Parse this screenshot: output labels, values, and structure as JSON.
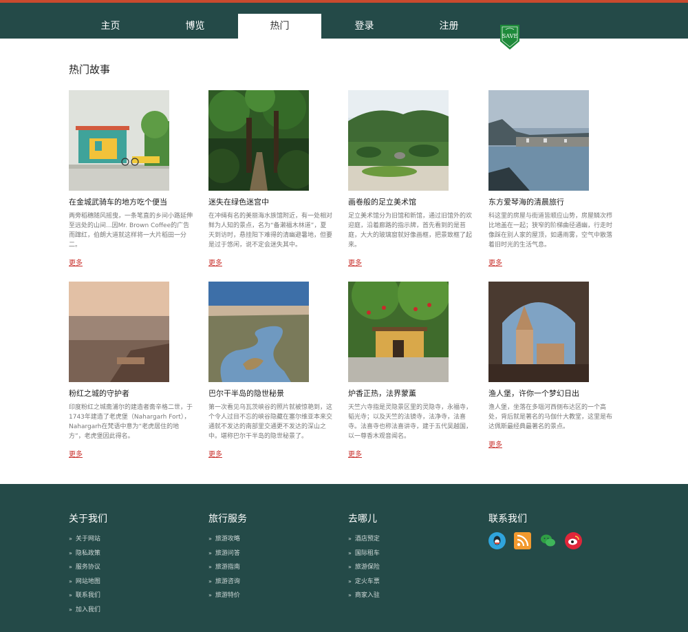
{
  "nav": {
    "items": [
      "主页",
      "博览",
      "热门",
      "登录",
      "注册"
    ],
    "active_index": 2,
    "save_badge": "SAVE"
  },
  "section": {
    "title": "热门故事"
  },
  "cards": [
    {
      "title": "在金城武骑车的地方吃个便当",
      "desc": "两旁稻穗随风摇曳，一条笔直的乡间小路延伸至远处的山间...因Mr. Brown Coffee的广告而蹿红，伯朗大道就这样将一大片稻田一分二。",
      "more": "更多"
    },
    {
      "title": "迷失在绿色迷宫中",
      "desc": "在冲绳有名的美丽海水族馆附近，有一处相对鲜为人知的景点，名为“备濑福木林道”，夏天到访时，悬挂阳下难得的清幽避暑地，但要是过于悠闲，说不定会迷失其中。",
      "more": "更多"
    },
    {
      "title": "画卷般的足立美术馆",
      "desc": "足立美术馆分为旧馆和新馆，通过旧馆外的欢迎庭，沿着廊路的指示牌，首先看到的是苔庭，大大的玻璃窗就好像画框，把景致框了起来。",
      "more": "更多"
    },
    {
      "title": "东方爱琴海的清晨旅行",
      "desc": "科这里的房屋与街道皆顺应山势，房屋鳞次栉比地盖在一起；狭窄的阶梯曲径通幽，行走时像踩在别人家的屋顶，如遇雨雾，空气中散落着旧时光的生活气息。",
      "more": "更多"
    },
    {
      "title": "粉红之城的守护者",
      "desc": "印度粉红之城斋浦尔的建造者斋辛格二世，于1743年建造了老虎堡（Nahargarh Fort），Nahargarh在梵语中意为“老虎居住的地方”，老虎堡因此得名。",
      "more": "更多"
    },
    {
      "title": "巴尔干半岛的隐世秘景",
      "desc": "第一次看见乌瓦茨峡谷的照片就被惊艳到，这个令人过目不忘的峡谷隐藏在塞尔维亚本来交通就不发达的南部里交通更不发达的深山之中。堪称巴尔干半岛的隐世秘景了。",
      "more": "更多"
    },
    {
      "title": "炉香正热，法界蒙薰",
      "desc": "天竺六寺指是灵隐景区里的灵隐寺，永福寺，韬光寺；以及天竺的法镜寺，法净寺，法喜寺。法喜寺也称法喜讲寺，建于五代吴越国，以一尊香木观音闻名。",
      "more": "更多"
    },
    {
      "title": "渔人堡，许你一个梦幻日出",
      "desc": "渔人堡，坐落在多瑙河西侧布达区的一个高处，背后就是著名的马伽什大教堂，这里是布达佩斯最经典最著名的景点。",
      "more": "更多"
    }
  ],
  "footer": {
    "about": {
      "title": "关于我们",
      "items": [
        "关于网站",
        "隐私政策",
        "服务协议",
        "网站地图",
        "联系我们",
        "加入我们"
      ]
    },
    "service": {
      "title": "旅行服务",
      "items": [
        "旅游攻略",
        "旅游问答",
        "旅游指南",
        "旅游咨询",
        "旅游特价"
      ]
    },
    "where": {
      "title": "去哪儿",
      "items": [
        "酒店预定",
        "国际租车",
        "旅游保险",
        "定火车票",
        "商家入驻"
      ]
    },
    "contact": {
      "title": "联系我们",
      "icons": [
        "qq-icon",
        "rss-icon",
        "wechat-icon",
        "weibo-icon"
      ]
    }
  },
  "colors": {
    "nav_bg": "#244a48",
    "accent_top": "#c94a2e",
    "more_link": "#c9302c",
    "save_green": "#1e8a3a"
  }
}
